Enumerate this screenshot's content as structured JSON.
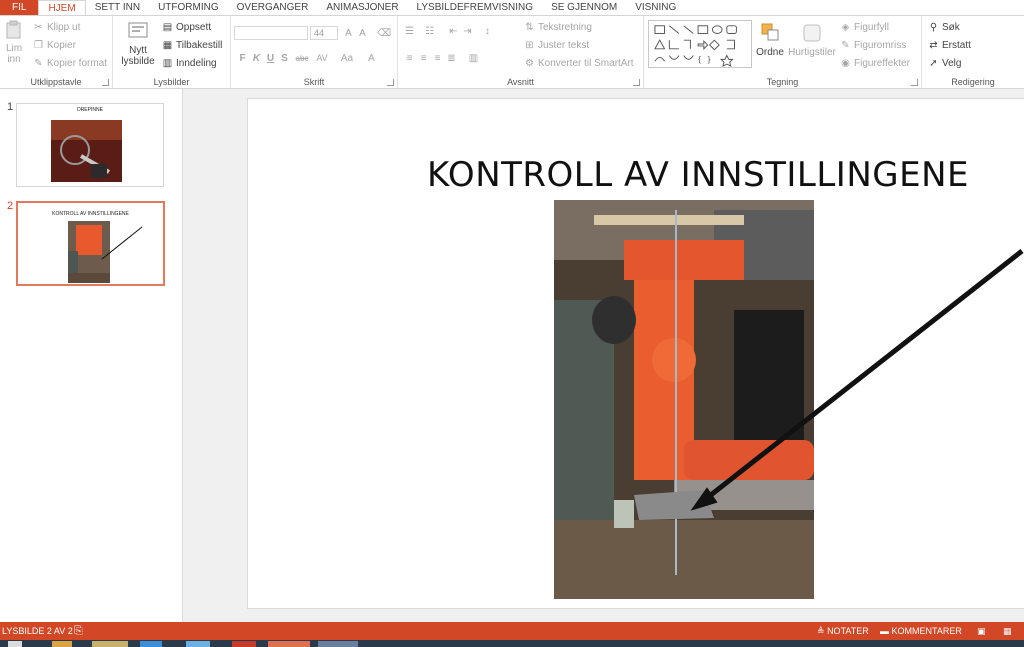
{
  "menu": {
    "tabs": [
      "FIL",
      "HJEM",
      "SETT INN",
      "UTFORMING",
      "OVERGANGER",
      "ANIMASJONER",
      "LYSBILDEFREMVISNING",
      "SE GJENNOM",
      "VISNING"
    ]
  },
  "ribbon": {
    "clipboard": {
      "paste_label_1": "Lim",
      "paste_label_2": "inn",
      "cut": "Klipp ut",
      "copy": "Kopier",
      "format_painter": "Kopier format",
      "group": "Utklippstavle"
    },
    "slides": {
      "new_slide_1": "Nytt",
      "new_slide_2": "lysbilde",
      "layout": "Oppsett",
      "reset": "Tilbakestill",
      "section": "Inndeling",
      "group": "Lysbilder"
    },
    "font": {
      "font_size": "44",
      "bold": "F",
      "italic": "K",
      "underline": "U",
      "shadow": "S",
      "strike": "abc",
      "spacing": "AV",
      "change_case": "Aa",
      "font_color": "A",
      "group": "Skrift"
    },
    "paragraph": {
      "text_direction": "Tekstretning",
      "align_text": "Juster tekst",
      "smartart": "Konverter til SmartArt",
      "group": "Avsnitt"
    },
    "drawing": {
      "arrange": "Ordne",
      "quick_styles": "Hurtigstiler",
      "shape_fill": "Figurfyll",
      "shape_outline": "Figuromriss",
      "shape_effects": "Figureffekter",
      "group": "Tegning"
    },
    "editing": {
      "find": "Søk",
      "replace": "Erstatt",
      "select": "Velg",
      "group": "Redigering"
    }
  },
  "thumbnails": [
    {
      "number": "1",
      "title": "DREPINNE"
    },
    {
      "number": "2",
      "title": "KONTROLL AV INNSTILLINGENE"
    }
  ],
  "slide": {
    "title": "KONTROLL AV INNSTILLINGENE"
  },
  "status": {
    "slide_info": "LYSBILDE 2 AV 2",
    "notes": "NOTATER",
    "comments": "KOMMENTARER"
  },
  "colors": {
    "accent": "#d24726",
    "selected_thumb_border": "#e07b5d"
  }
}
